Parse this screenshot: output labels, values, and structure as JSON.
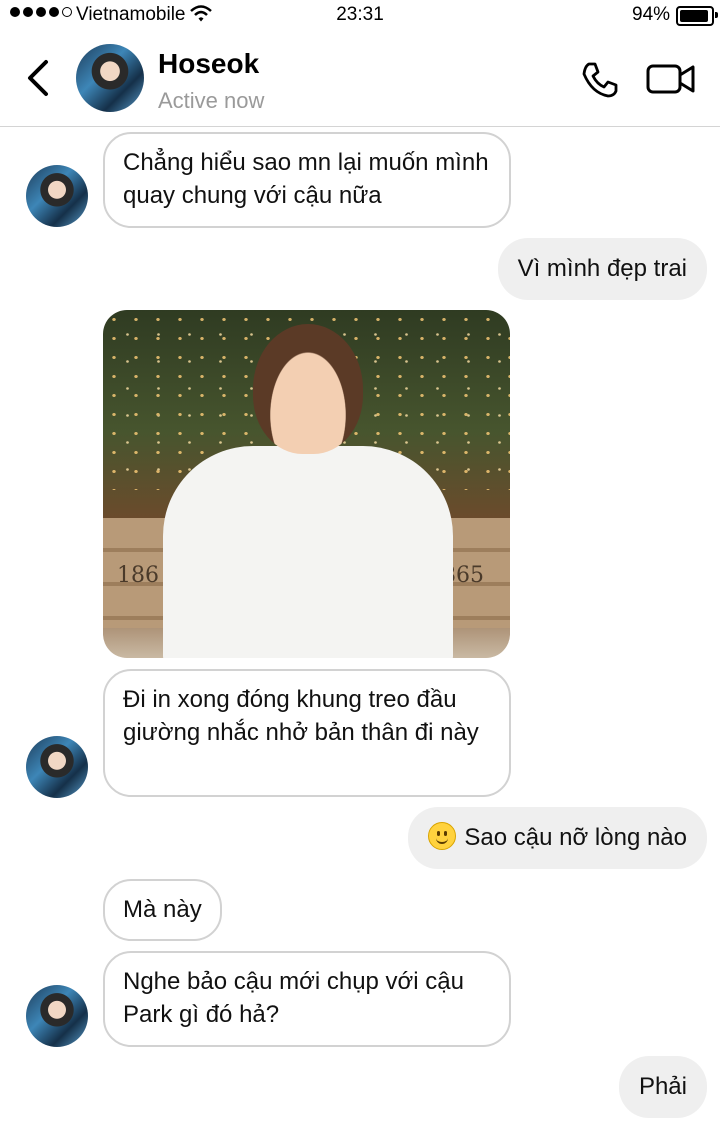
{
  "status_bar": {
    "carrier": "Vietnamobile",
    "time": "23:31",
    "battery_percent": "94%",
    "signal_icon": "signal-dots-icon",
    "wifi_icon": "wifi-icon"
  },
  "header": {
    "contact_name": "Hoseok",
    "presence": "Active now",
    "back_icon": "chevron-left-icon",
    "call_icon": "phone-icon",
    "video_icon": "video-camera-icon"
  },
  "messages": [
    {
      "side": "in",
      "text": "Chẳng hiểu sao mn lại muốn mình quay chung với cậu nữa"
    },
    {
      "side": "out",
      "text": "Vì mình đẹp trai"
    },
    {
      "side": "in",
      "type": "photo",
      "crate_text_left": "186",
      "crate_text_right": "1865"
    },
    {
      "side": "in",
      "text": "Đi in xong đóng khung treo đầu giường nhắc nhở bản thân đi này"
    },
    {
      "side": "out",
      "emoji": "slightly-smiling-face-icon",
      "text": "Sao cậu nỡ lòng nào"
    },
    {
      "side": "in",
      "text": "Mà này"
    },
    {
      "side": "in",
      "text": "Nghe bảo cậu mới chụp với cậu Park gì đó hả?"
    },
    {
      "side": "out",
      "text": "Phải"
    }
  ],
  "colors": {
    "incoming_border": "#d2d2d2",
    "outgoing_bg": "#efefef",
    "presence_gray": "#9a9a9a"
  }
}
